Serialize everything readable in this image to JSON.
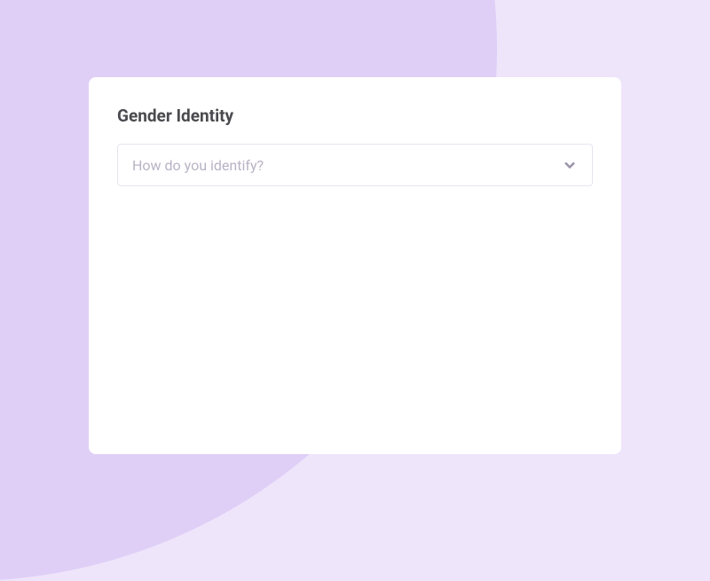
{
  "form": {
    "title": "Gender Identity",
    "dropdown": {
      "placeholder": "How do you identify?"
    }
  }
}
